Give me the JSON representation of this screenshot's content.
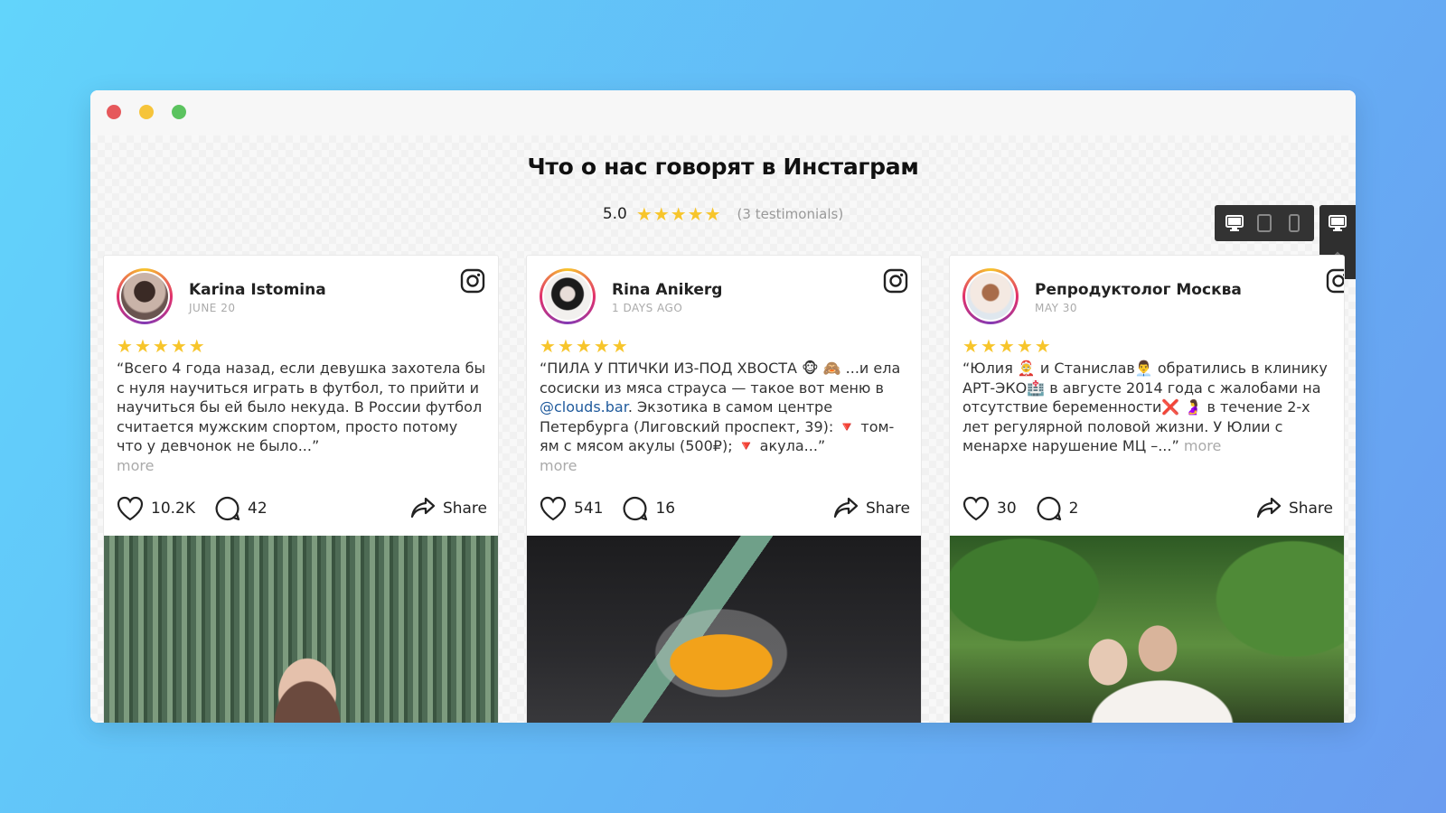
{
  "page": {
    "heading": "Что о нас говорят в Инстаграм",
    "rating": "5.0",
    "testimonials_count": "(3 testimonials)",
    "star_color": "#f7c52b",
    "accent_gradient": [
      "#f7c52b",
      "#e1306c",
      "#833ab4"
    ]
  },
  "window": {
    "controls": [
      "close",
      "minimize",
      "zoom"
    ]
  },
  "toolbar": {
    "devices": [
      "desktop-icon",
      "tablet-icon",
      "mobile-icon"
    ],
    "side": [
      "desktop-icon",
      "paint-bucket-icon"
    ]
  },
  "cards": [
    {
      "name": "Karina Istomina",
      "date": "JUNE 20",
      "rating": 5,
      "text": "“Всего 4 года назад, если девушка захотела бы с нуля научиться играть в футбол, то прийти и научиться бы ей было некуда. В России футбол считается мужским спортом, просто потому что у девчонок не было...”",
      "more": "more",
      "likes": "10.2K",
      "comments": "42",
      "share": "Share"
    },
    {
      "name": "Rina Anikerg",
      "date": "1 DAYS AGO",
      "rating": 5,
      "text_before": "“ПИЛА У ПТИЧКИ ИЗ-ПОД ХВОСТА 🐵 🙈  ...и ела сосиски из мяса страуса — такое вот меню в ",
      "mention": "@clouds.bar",
      "text_after": ". Экзотика в самом центре Петербурга (Лиговский проспект, 39): 🔻 том-ям с мясом акулы (500₽); 🔻 акула...”",
      "more": "more",
      "likes": "541",
      "comments": "16",
      "share": "Share"
    },
    {
      "name": "Репродуктолог Москва",
      "date": "MAY 30",
      "rating": 5,
      "text": "“Юлия 🤶 и Станислав👨‍💼  обратились в клинику АРТ-ЭКО🏥  в августе 2014 года с жалобами на отсутствие беременности❌ 🤰  в течение 2-х лет регулярной половой жизни. У Юлии с менархе нарушение МЦ –...”",
      "more": "more",
      "likes": "30",
      "comments": "2",
      "share": "Share"
    }
  ]
}
